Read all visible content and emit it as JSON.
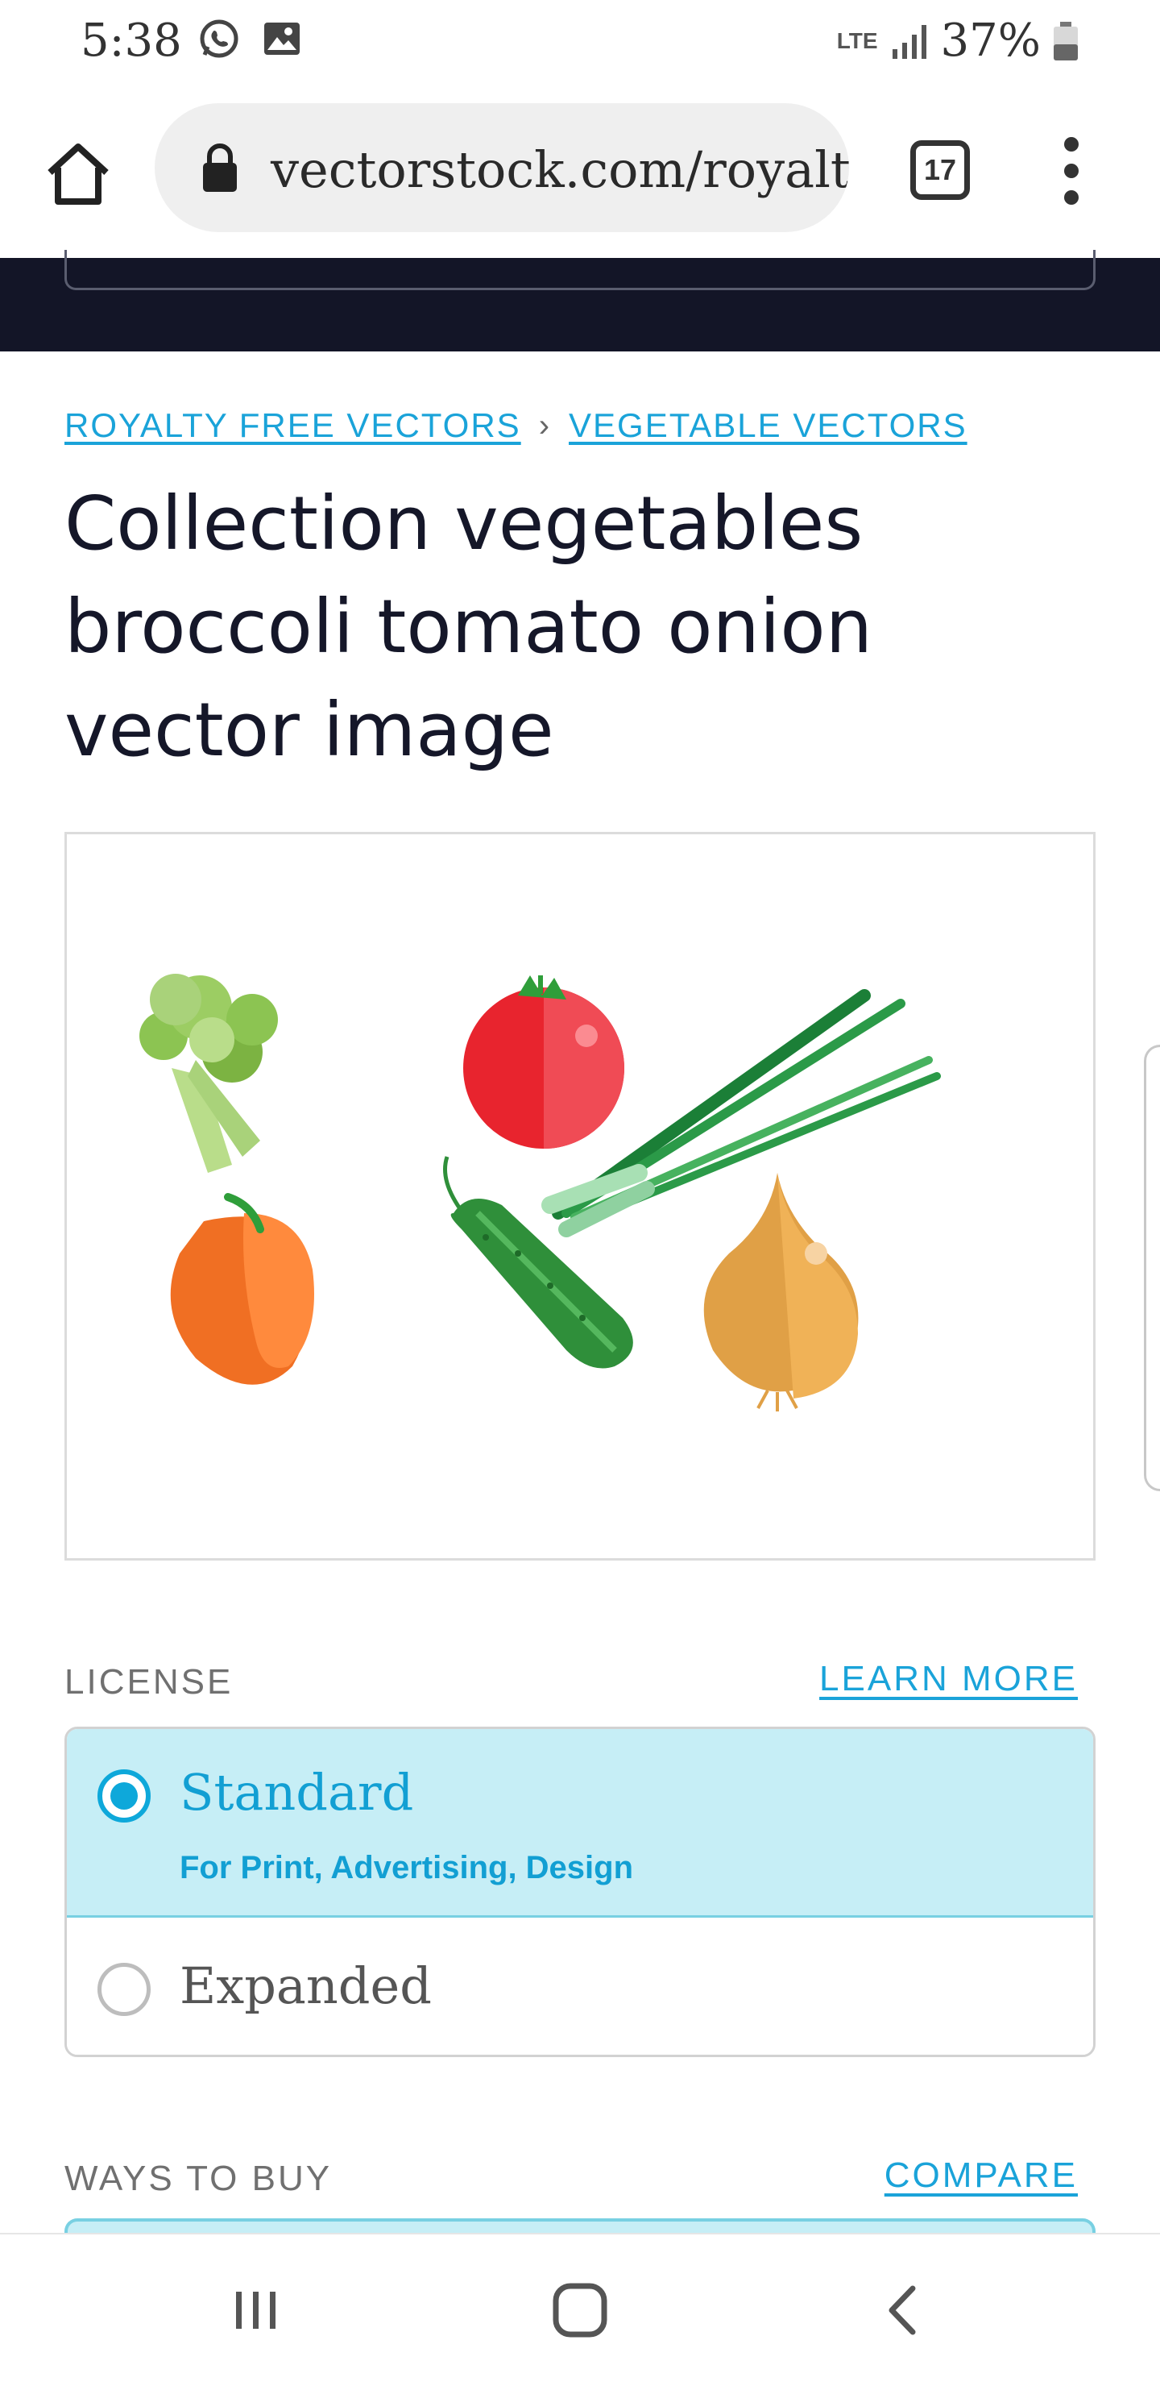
{
  "status_bar": {
    "time": "5:38",
    "network": "LTE",
    "battery": "37%"
  },
  "browser": {
    "url": "vectorstock.com/royalty",
    "tab_count": "17"
  },
  "breadcrumb": {
    "items": [
      "ROYALTY FREE VECTORS",
      "VEGETABLE VECTORS"
    ],
    "separator": "›"
  },
  "page": {
    "title": "Collection vegetables broccoli tomato onion vector image"
  },
  "license": {
    "label": "LICENSE",
    "learn_more": "LEARN MORE",
    "options": [
      {
        "title": "Standard",
        "subtitle": "For Print, Advertising, Design",
        "selected": true
      },
      {
        "title": "Expanded",
        "selected": false
      }
    ]
  },
  "ways_to_buy": {
    "label": "WAYS TO BUY",
    "compare": "COMPARE"
  },
  "colors": {
    "accent": "#1aa3d9",
    "header_dark": "#131527",
    "selected_bg": "#c6eef6"
  },
  "icons": {
    "home": "home-icon",
    "lock": "lock-icon",
    "menu": "more-vert-icon",
    "nav_recents": "recents-icon",
    "nav_home": "nav-home-icon",
    "nav_back": "back-icon"
  }
}
